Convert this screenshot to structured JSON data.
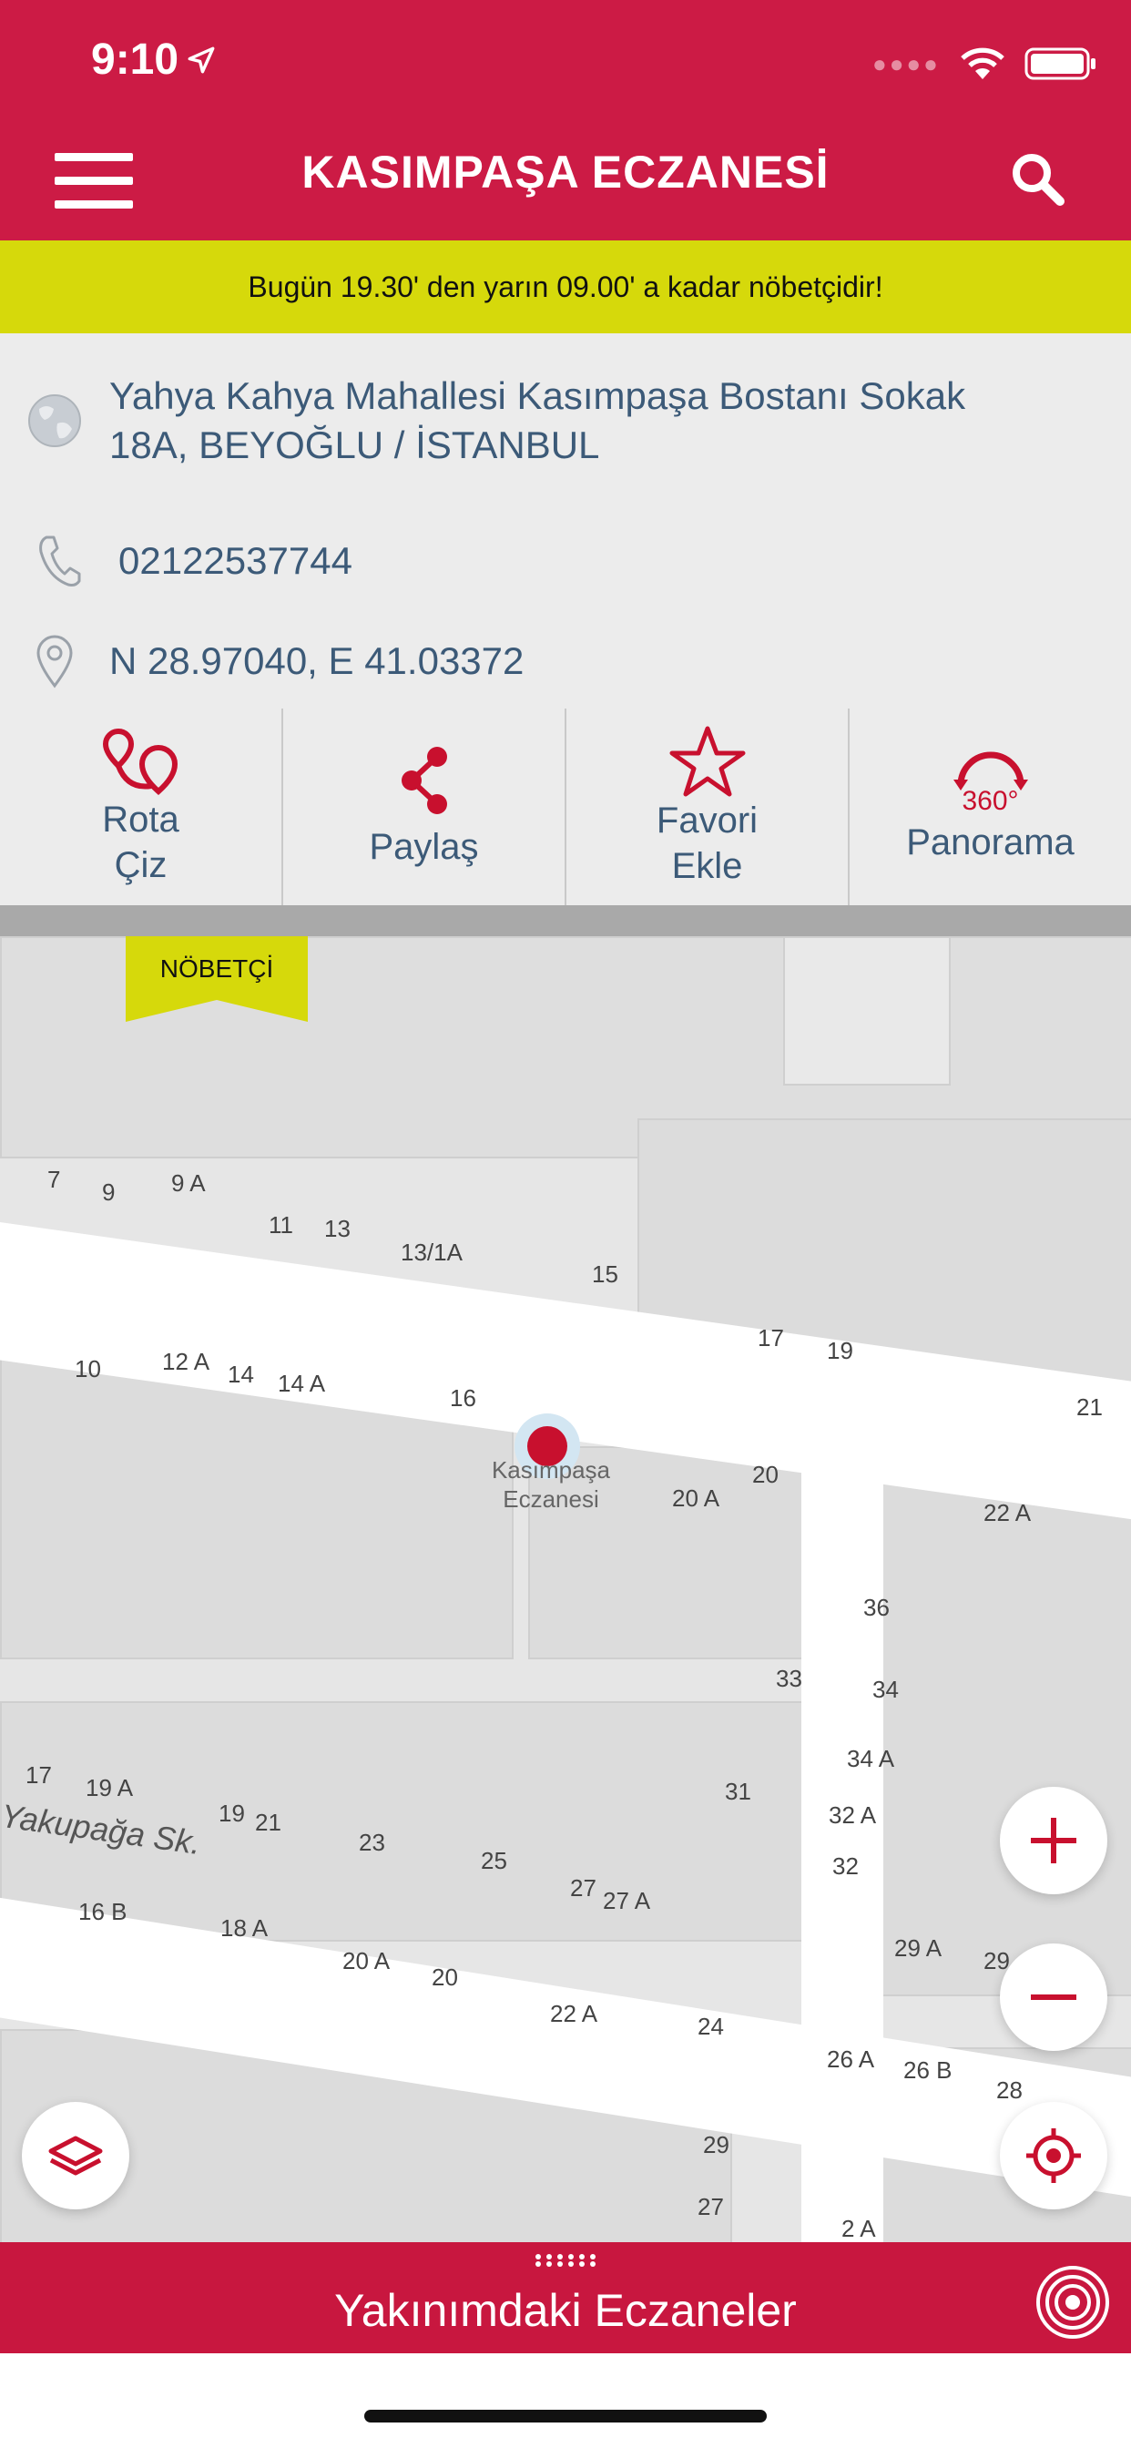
{
  "status_bar": {
    "time": "9:10"
  },
  "header": {
    "title": "KASIMPAŞA ECZANESİ"
  },
  "duty_banner": {
    "text": "Bugün 19.30' den yarın 09.00' a kadar nöbetçidir!"
  },
  "info": {
    "address_line1": "Yahya Kahya Mahallesi Kasımpaşa Bostanı Sokak",
    "address_line2": "18A, BEYOĞLU / İSTANBUL",
    "phone": "02122537744",
    "coordinates": "N 28.97040, E 41.03372"
  },
  "actions": {
    "route_line1": "Rota",
    "route_line2": "Çiz",
    "share": "Paylaş",
    "favorite_line1": "Favori",
    "favorite_line2": "Ekle",
    "panorama": "Panorama",
    "panorama_badge": "360°"
  },
  "map": {
    "tag": "NÖBETÇİ",
    "marker_label_line1": "Kasımpaşa",
    "marker_label_line2": "Eczanesi",
    "street_name": "Yakupağa Sk.",
    "house_numbers": [
      "7",
      "9",
      "9 A",
      "11",
      "13",
      "13/1A",
      "15",
      "17",
      "19",
      "21",
      "10",
      "12 A",
      "14",
      "14 A",
      "16",
      "20",
      "20 A",
      "22 A",
      "36",
      "33",
      "34",
      "34 A",
      "31",
      "32 A",
      "32",
      "17",
      "19 A",
      "19",
      "21",
      "23",
      "25",
      "27",
      "27 A",
      "16 B",
      "18 A",
      "20 A",
      "20",
      "22 A",
      "24",
      "29 A",
      "29",
      "26 A",
      "26 B",
      "28",
      "29",
      "27",
      "2 A"
    ]
  },
  "bottom_bar": {
    "label": "Yakınımdaki Eczaneler"
  },
  "colors": {
    "brand": "#cc1b45",
    "banner": "#d6d90b",
    "info_text": "#3c5a78",
    "accent_red": "#c8102e"
  }
}
